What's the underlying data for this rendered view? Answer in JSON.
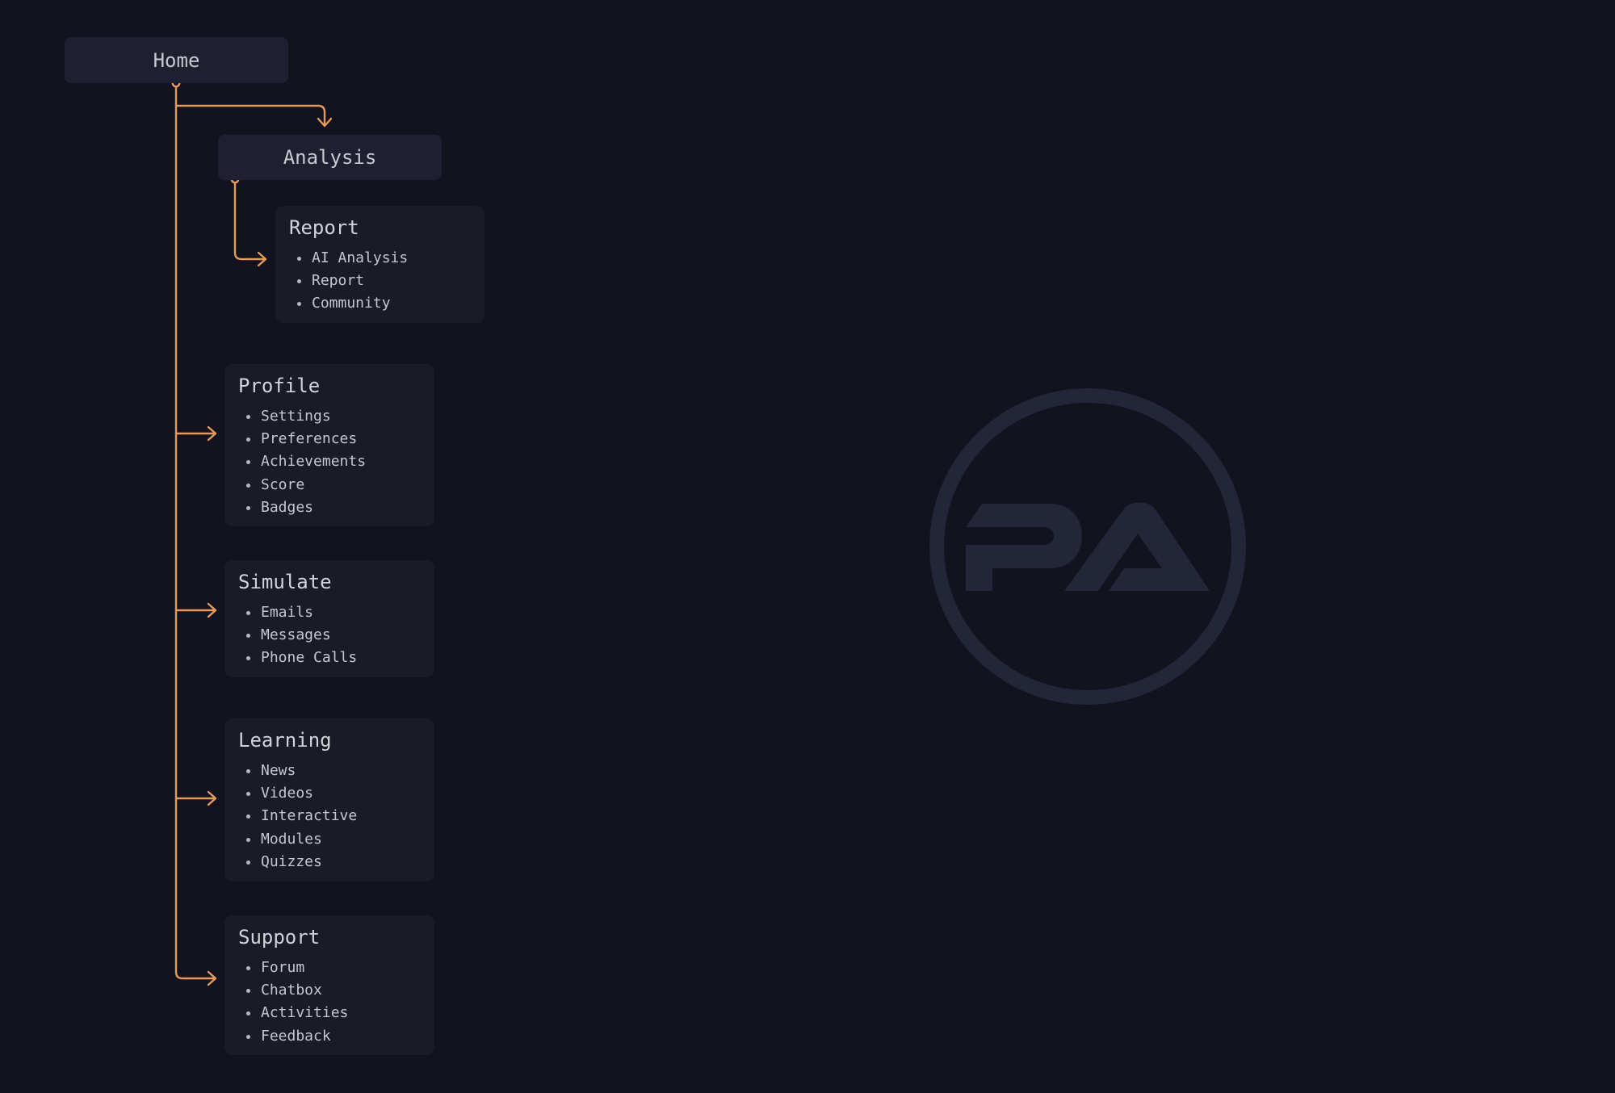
{
  "diagram": {
    "root": {
      "label": "Home"
    },
    "analysis": {
      "label": "Analysis"
    },
    "cards": [
      {
        "id": "report",
        "title": "Report",
        "items": [
          "AI Analysis",
          "Report",
          "Community"
        ]
      },
      {
        "id": "profile",
        "title": "Profile",
        "items": [
          "Settings",
          "Preferences",
          "Achievements",
          "Score",
          "Badges"
        ]
      },
      {
        "id": "simulate",
        "title": "Simulate",
        "items": [
          "Emails",
          "Messages",
          "Phone Calls"
        ]
      },
      {
        "id": "learning",
        "title": "Learning",
        "items": [
          "News",
          "Videos",
          "Interactive",
          "Modules",
          "Quizzes"
        ]
      },
      {
        "id": "support",
        "title": "Support",
        "items": [
          "Forum",
          "Chatbox",
          "Activities",
          "Feedback"
        ]
      }
    ]
  },
  "logo": {
    "text": "PA",
    "icon": "pa-logo-icon"
  },
  "colors": {
    "background": "#13131f",
    "connector": "#e39a5c",
    "node_bg": "#1e1f30",
    "card_bg": "#191b27",
    "logo": "#232638",
    "text": "#c9cad0"
  }
}
